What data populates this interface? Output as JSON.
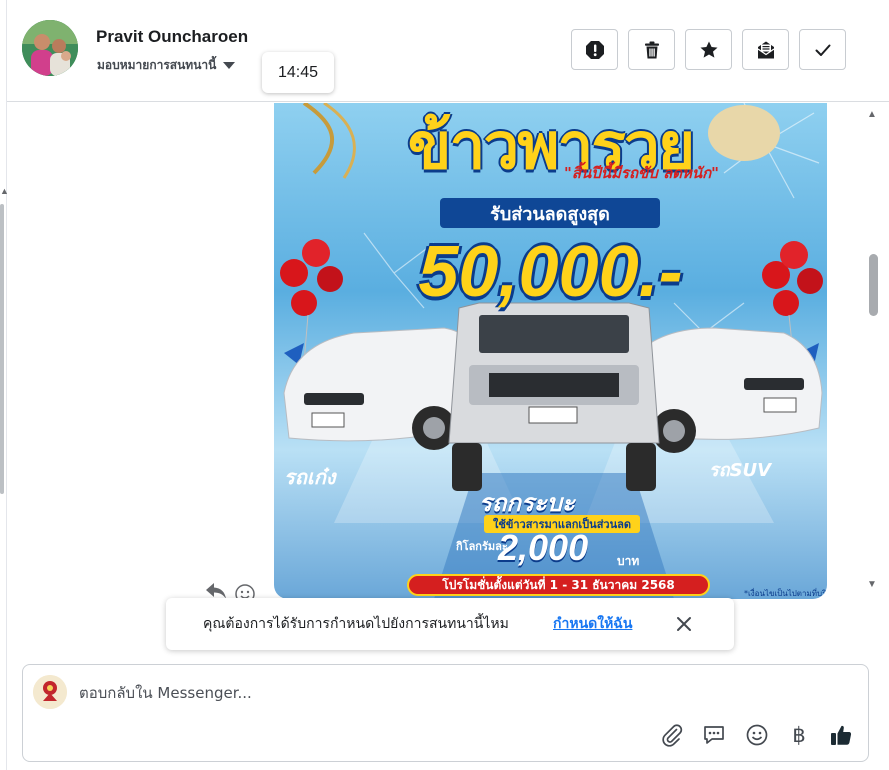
{
  "header": {
    "contact_name": "Pravit Ouncharoen",
    "assign_label": "มอบหมายการสนทนานี้",
    "time_tooltip": "14:45",
    "actions": [
      {
        "name": "spam",
        "icon": "alert-octagon-icon"
      },
      {
        "name": "delete",
        "icon": "trash-icon"
      },
      {
        "name": "star",
        "icon": "star-icon"
      },
      {
        "name": "mark-unread",
        "icon": "envelope-icon"
      },
      {
        "name": "done",
        "icon": "check-icon"
      }
    ]
  },
  "message": {
    "image": {
      "title": "ข้าวพารวย",
      "slogan": "\"สิ้นปีนี้มีรถขับ ลดหนัก\"",
      "discount_label": "รับส่วนลดสูงสุด",
      "discount_amount": "50,000.-",
      "sedan_label": "รถเก๋ง",
      "suv_label": "รถSUV",
      "pickup_label": "รถกระบะ",
      "trade_label": "ใช้ข้าวสารมาแลกเป็นส่วนลด",
      "per_kg_label": "กิโลกรัมละ",
      "per_kg_amount": "2,000",
      "baht_label": "บาท",
      "period": "โปรโมชั่นตั้งแต่วันที่ 1 - 31 ธันวาคม 2568",
      "fineprint": "*เงื่อนไขเป็นไปตามที่บริษัทฯ กำหนด"
    }
  },
  "assign_banner": {
    "text": "คุณต้องการได้รับการกำหนดไปยังการสนทนานี้ไหม",
    "link": "กำหนดให้ฉัน"
  },
  "composer": {
    "placeholder": "ตอบกลับใน Messenger...",
    "tools": [
      "paperclip-icon",
      "saved-reply-icon",
      "emoji-icon",
      "baht-icon",
      "thumbs-up-icon"
    ],
    "baht_symbol": "฿"
  }
}
